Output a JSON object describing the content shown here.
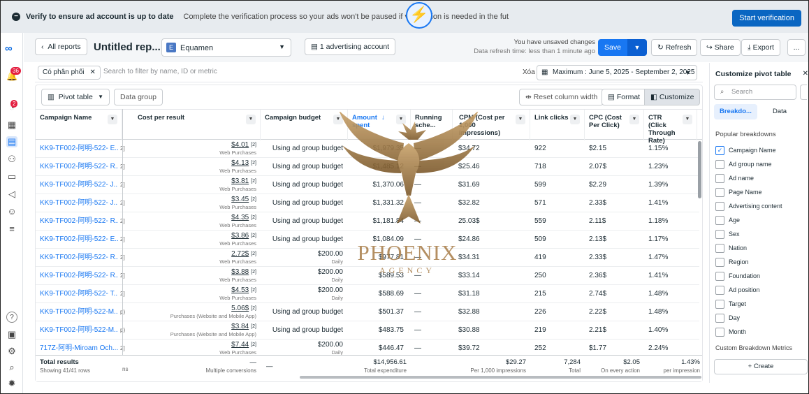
{
  "banner": {
    "title": "Verify to ensure ad account is up to date",
    "desc": "Complete the verification process so your ads won't be paused if verification is needed in the fut",
    "button": "Start verification"
  },
  "rail": {
    "badge_notif": "36",
    "badge_msg": "2"
  },
  "toolbar": {
    "all_reports": "All reports",
    "title": "Untitled rep...",
    "account_initial": "E",
    "account_name": "Equamen",
    "adv_accounts": "1 advertising account",
    "unsaved": "You have unsaved changes",
    "refresh_time": "Data refresh time: less than 1 minute ago",
    "save": "Save",
    "refresh": "Refresh",
    "share": "Share",
    "export": "Export",
    "more": "..."
  },
  "filter": {
    "chip": "Có phân phối",
    "placeholder": "Search to filter by name, ID or metric",
    "clear": "Xóa",
    "date_range": "Maximum : June 5, 2025 - September 2, 2025"
  },
  "table_toolbar": {
    "pivot": "Pivot table",
    "data_group": "Data group",
    "reset": "Reset column width",
    "format": "Format",
    "customize": "Customize"
  },
  "columns": {
    "campaign": "Campaign Name",
    "cpr": "Cost per result",
    "budget": "Campaign budget",
    "amount": "Amount spent",
    "running": "Running sche...",
    "cpm": "CPM (Cost per 1,000 impressions)",
    "clicks": "Link clicks",
    "cpc": "CPC (Cost Per Click)",
    "ctr": "CTR (Click Through Rate)"
  },
  "rows": [
    {
      "name": "KK9-TF002-阿明-522- E...",
      "edge": "2]",
      "cpr": "$4.01",
      "n": "[2]",
      "cpr_sub": "Web Purchases",
      "budget": "Using ad group budget",
      "budget_sub": "",
      "amount": "$1,979.35",
      "running": "—",
      "cpm": "$34.72",
      "clicks": "922",
      "cpc": "$2.15",
      "ctr": "1.15%"
    },
    {
      "name": "KK9-TF002-阿明-522- R...",
      "edge": "2]",
      "cpr": "$4.13",
      "n": "[2]",
      "cpr_sub": "Web Purchases",
      "budget": "Using ad group budget",
      "budget_sub": "",
      "amount": "$1,485.12",
      "running": "—",
      "cpm": "$25.46",
      "clicks": "718",
      "cpc": "2.07$",
      "ctr": "1.23%"
    },
    {
      "name": "KK9-TF002-阿明-522- J...",
      "edge": "2]",
      "cpr": "$3.81",
      "n": "[2]",
      "cpr_sub": "Web Purchases",
      "budget": "Using ad group budget",
      "budget_sub": "",
      "amount": "$1,370.06",
      "running": "—",
      "cpm": "$31.69",
      "clicks": "599",
      "cpc": "$2.29",
      "ctr": "1.39%"
    },
    {
      "name": "KK9-TF002-阿明-522- J...",
      "edge": "2]",
      "cpr": "$3.45",
      "n": "[2]",
      "cpr_sub": "Web Purchases",
      "budget": "Using ad group budget",
      "budget_sub": "",
      "amount": "$1,331.32",
      "running": "—",
      "cpm": "$32.82",
      "clicks": "571",
      "cpc": "2.33$",
      "ctr": "1.41%"
    },
    {
      "name": "KK9-TF002-阿明-522- R...",
      "edge": "2]",
      "cpr": "$4.35",
      "n": "[2]",
      "cpr_sub": "Web Purchases",
      "budget": "Using ad group budget",
      "budget_sub": "",
      "amount": "$1,181.84",
      "running": "—",
      "cpm": "25.03$",
      "clicks": "559",
      "cpc": "2.11$",
      "ctr": "1.18%"
    },
    {
      "name": "KK9-TF002-阿明-522- E...",
      "edge": "2]",
      "cpr": "$3.86",
      "n": "[2]",
      "cpr_sub": "Web Purchases",
      "budget": "Using ad group budget",
      "budget_sub": "",
      "amount": "$1,084.09",
      "running": "—",
      "cpm": "$24.86",
      "clicks": "509",
      "cpc": "2.13$",
      "ctr": "1.17%"
    },
    {
      "name": "KK9-TF002-阿明-522- R...",
      "edge": "2]",
      "cpr": "2.72$",
      "n": "[2]",
      "cpr_sub": "Web Purchases",
      "budget": "$200.00",
      "budget_sub": "Daily",
      "amount": "$977.81",
      "running": "—",
      "cpm": "$34.31",
      "clicks": "419",
      "cpc": "2.33$",
      "ctr": "1.47%"
    },
    {
      "name": "KK9-TF002-阿明-522- R...",
      "edge": "2]",
      "cpr": "$3.88",
      "n": "[2]",
      "cpr_sub": "Web Purchases",
      "budget": "$200.00",
      "budget_sub": "Daily",
      "amount": "$589.53",
      "running": "—",
      "cpm": "$33.14",
      "clicks": "250",
      "cpc": "2.36$",
      "ctr": "1.41%"
    },
    {
      "name": "KK9-TF002-阿明-522- T...",
      "edge": "2]",
      "cpr": "$4.53",
      "n": "[2]",
      "cpr_sub": "Web Purchases",
      "budget": "$200.00",
      "budget_sub": "Daily",
      "amount": "$588.69",
      "running": "—",
      "cpm": "$31.18",
      "clicks": "215",
      "cpc": "2.74$",
      "ctr": "1.48%"
    },
    {
      "name": "KK9-TF002-阿明-522-M...",
      "edge": "p)",
      "cpr": "5.06$",
      "n": "[2]",
      "cpr_sub": "Purchases (Website and Mobile App)",
      "budget": "Using ad group budget",
      "budget_sub": "",
      "amount": "$501.37",
      "running": "—",
      "cpm": "$32.88",
      "clicks": "226",
      "cpc": "2.22$",
      "ctr": "1.48%"
    },
    {
      "name": "KK9-TF002-阿明-522-M...",
      "edge": "p)",
      "cpr": "$3.84",
      "n": "[2]",
      "cpr_sub": "Purchases (Website and Mobile App)",
      "budget": "Using ad group budget",
      "budget_sub": "",
      "amount": "$483.75",
      "running": "—",
      "cpm": "$30.88",
      "clicks": "219",
      "cpc": "2.21$",
      "ctr": "1.40%"
    },
    {
      "name": "717Z-阿明-Miroam Och...",
      "edge": "2]",
      "cpr": "$7.44",
      "n": "[2]",
      "cpr_sub": "Web Purchases",
      "budget": "$200.00",
      "budget_sub": "Daily",
      "amount": "$446.47",
      "running": "—",
      "cpm": "$39.72",
      "clicks": "252",
      "cpc": "$1.77",
      "ctr": "2.24%"
    }
  ],
  "footer": {
    "label": "Total results",
    "sub": "Showing 41/41 rows",
    "edge": "ns",
    "cpr": "—",
    "cpr_sub": "Multiple conversions",
    "budget": "—",
    "amount": "$14,956.61",
    "amount_sub": "Total expenditure",
    "cpm": "$29.27",
    "cpm_sub": "Per 1,000 impressions",
    "clicks": "7,284",
    "clicks_sub": "Total",
    "cpc": "$2.05",
    "cpc_sub": "On every action",
    "ctr": "1.43%",
    "ctr_sub": "per impression"
  },
  "panel": {
    "title": "Customize pivot table",
    "search": "Search",
    "tab_breakdown": "Breakdo...",
    "tab_data": "Data",
    "popular": "Popular breakdowns",
    "items": [
      "Campaign Name",
      "Ad group name",
      "Ad name",
      "Page Name",
      "Advertising content",
      "Age",
      "Sex",
      "Nation",
      "Region",
      "Foundation",
      "Ad position",
      "Target",
      "Day",
      "Month"
    ],
    "custom": "Custom Breakdown Metrics",
    "create": "+ Create"
  },
  "watermark": {
    "name": "PHOENIX",
    "sub": "AGENCY"
  },
  "colors": {
    "accent": "#1877f2",
    "gold": "#a77c47"
  }
}
